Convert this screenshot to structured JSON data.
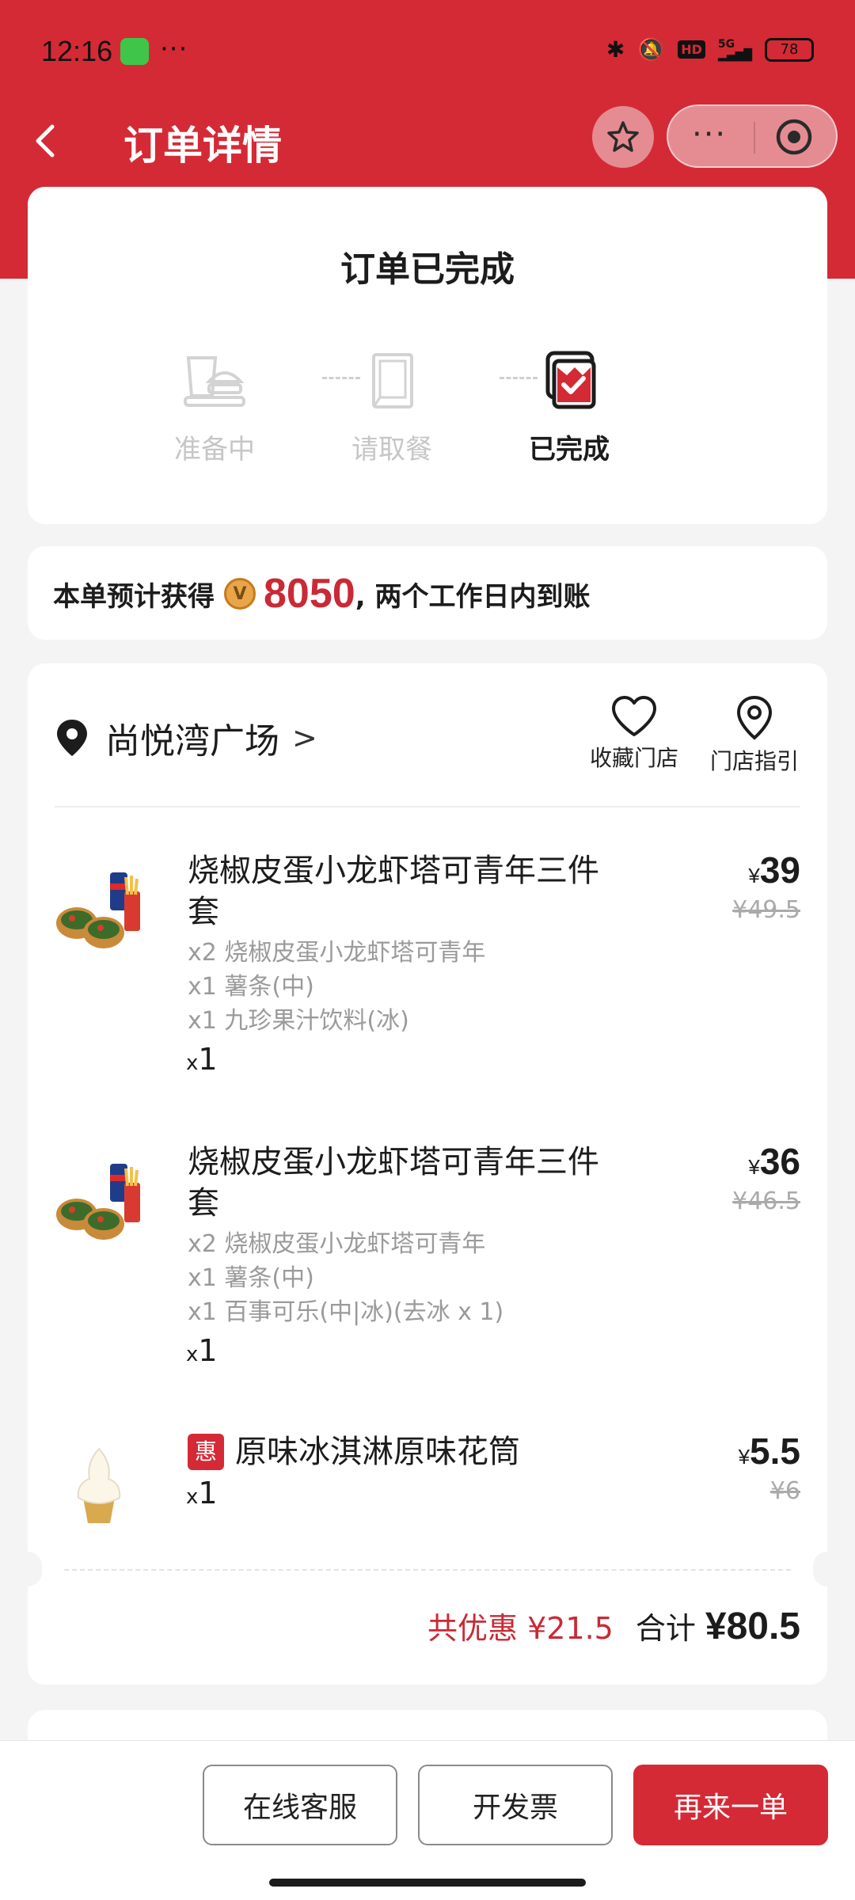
{
  "status_bar": {
    "time": "12:16",
    "more": "···",
    "hd": "HD",
    "network": "5G",
    "battery": "78"
  },
  "nav": {
    "title": "订单详情",
    "more": "···"
  },
  "status": {
    "title": "订单已完成",
    "steps": [
      {
        "label": "准备中",
        "icon": "burger-tray-icon",
        "active": false
      },
      {
        "label": "请取餐",
        "icon": "kfc-bag-icon",
        "active": false
      },
      {
        "label": "已完成",
        "icon": "completed-check-icon",
        "active": true
      }
    ]
  },
  "points": {
    "prefix": "本单预计获得",
    "coin": "V",
    "amount": "8050",
    "suffix": ", 两个工作日内到账"
  },
  "store": {
    "name": "尚悦湾广场",
    "chevron": ">",
    "favorite_label": "收藏门店",
    "guide_label": "门店指引"
  },
  "items": [
    {
      "name": "烧椒皮蛋小龙虾塔可青年三件套",
      "components": [
        "x2 烧椒皮蛋小龙虾塔可青年",
        "x1 薯条(中)",
        "x1 九珍果汁饮料(冰)"
      ],
      "qty_x": "x",
      "qty": "1",
      "yen": "¥",
      "price": "39",
      "original": "¥49.5"
    },
    {
      "name": "烧椒皮蛋小龙虾塔可青年三件套",
      "components": [
        "x2 烧椒皮蛋小龙虾塔可青年",
        "x1 薯条(中)",
        "x1 百事可乐(中|冰)(去冰 x 1)"
      ],
      "qty_x": "x",
      "qty": "1",
      "yen": "¥",
      "price": "36",
      "original": "¥46.5"
    },
    {
      "badge": "惠",
      "name": "原味冰淇淋原味花筒",
      "qty_x": "x",
      "qty": "1",
      "yen": "¥",
      "price": "5.5",
      "original": "¥6"
    }
  ],
  "totals": {
    "saving": "共优惠 ¥21.5",
    "label": "合计",
    "amount": "¥80.5"
  },
  "actions": {
    "service": "在线客服",
    "invoice": "开发票",
    "reorder": "再来一单"
  },
  "colors": {
    "brand_red": "#d42a36",
    "price_red": "#c92a35"
  }
}
